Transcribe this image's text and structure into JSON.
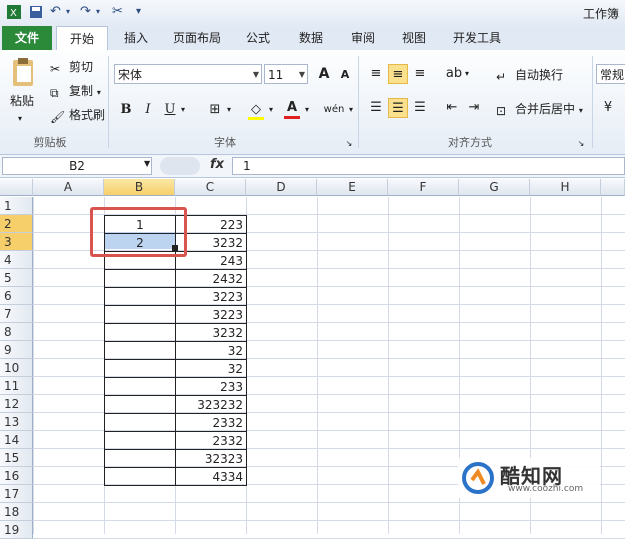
{
  "window": {
    "title": "工作簿"
  },
  "tabs": [
    {
      "label": "文件"
    },
    {
      "label": "开始"
    },
    {
      "label": "插入"
    },
    {
      "label": "页面布局"
    },
    {
      "label": "公式"
    },
    {
      "label": "数据"
    },
    {
      "label": "审阅"
    },
    {
      "label": "视图"
    },
    {
      "label": "开发工具"
    }
  ],
  "clipboard": {
    "paste": "粘贴",
    "cut": "剪切",
    "copy": "复制",
    "format_painter": "格式刷",
    "group": "剪贴板"
  },
  "font": {
    "name": "宋体",
    "size": "11",
    "grow": "A",
    "shrink": "A",
    "bold": "B",
    "italic": "I",
    "underline": "U",
    "group": "字体",
    "phonetic": "wén"
  },
  "alignment": {
    "wrap": "自动换行",
    "merge": "合并后居中",
    "group": "对齐方式"
  },
  "number": {
    "format": "常规"
  },
  "formula_bar": {
    "name_box": "B2",
    "fx": "fx",
    "value": "1"
  },
  "columns": [
    "A",
    "B",
    "C",
    "D",
    "E",
    "F",
    "G",
    "H"
  ],
  "rows": [
    "1",
    "2",
    "3",
    "4",
    "5",
    "6",
    "7",
    "8",
    "9",
    "10",
    "11",
    "12",
    "13",
    "14",
    "15",
    "16",
    "17",
    "18",
    "19"
  ],
  "col_b": [
    "1",
    "2"
  ],
  "col_c": [
    "223",
    "3232",
    "243",
    "2432",
    "3223",
    "3223",
    "3232",
    "32",
    "32",
    "233",
    "323232",
    "2332",
    "2332",
    "32323",
    "4334"
  ],
  "watermark": {
    "text": "酷知网",
    "url": "www.coozhi.com"
  },
  "colors": {
    "file_tab": "#2a8a3a",
    "highlight": "#d9534f",
    "selection": "#bcd4f0"
  }
}
